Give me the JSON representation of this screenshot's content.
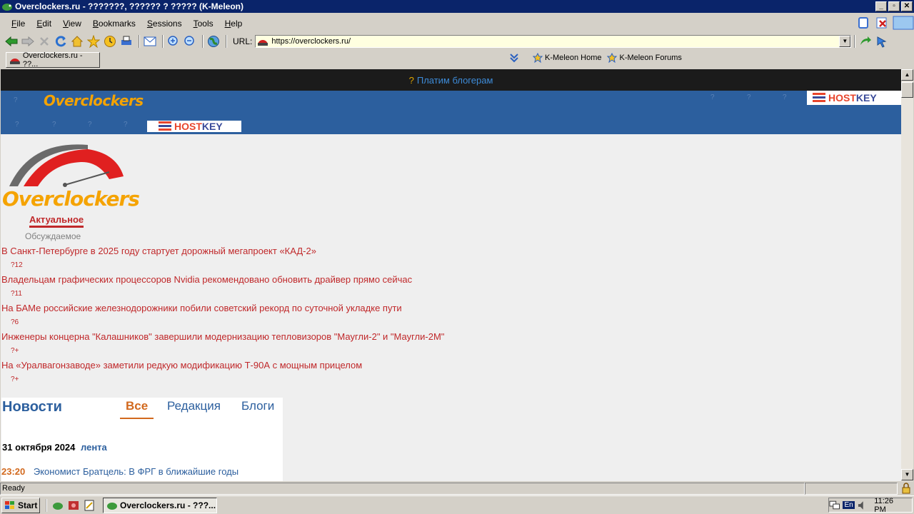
{
  "window": {
    "title": "Overclockers.ru - ???????, ?????? ? ????? (K-Meleon)"
  },
  "menu": {
    "items": [
      "File",
      "Edit",
      "View",
      "Bookmarks",
      "Sessions",
      "Tools",
      "Help"
    ],
    "accel": [
      "F",
      "E",
      "V",
      "B",
      "S",
      "T",
      "H"
    ]
  },
  "toolbar": {
    "url_label": "URL:",
    "url": "https://overclockers.ru/"
  },
  "tabs": [
    {
      "label": "Overclockers.ru - ??..."
    }
  ],
  "bookmarks": [
    {
      "label": "K-Meleon Home"
    },
    {
      "label": "K-Meleon Forums"
    }
  ],
  "page": {
    "banner_mark": "?",
    "banner_text": "Платим блогерам",
    "header_logo": "Overclockers",
    "hostkey_a": "HOST",
    "hostkey_b": "KEY",
    "big_logo": "Overclockers",
    "nav_active": "Актуальное",
    "nav_other": "Обсуждаемое",
    "news": [
      {
        "title": "В Санкт-Петербурге в 2025 году стартует дорожный мегапроект «КАД-2»",
        "meta": "?12"
      },
      {
        "title": "Владельцам графических процессоров Nvidia рекомендовано обновить драйвер прямо сейчас",
        "meta": "?11"
      },
      {
        "title": "На БАМе российские железнодорожники побили советский рекорд по суточной укладке пути",
        "meta": "?6"
      },
      {
        "title": "Инженеры концерна \"Калашников\" завершили модернизацию тепловизоров \"Маугли-2\" и \"Маугли-2М\"",
        "meta": "?+"
      },
      {
        "title": "На «Уралвагонзаводе» заметили редкую модификацию Т-90А с мощным прицелом",
        "meta": "?+"
      }
    ],
    "newsbox": {
      "heading": "Новости",
      "tabs": [
        "Все",
        "Редакция",
        "Блоги"
      ],
      "date": "31 октября 2024",
      "lenta": "лента",
      "item_time": "23:20",
      "item_text": "Экономист Братцель: В ФРГ в ближайшие годы"
    }
  },
  "status": {
    "text": "Ready"
  },
  "taskbar": {
    "start": "Start",
    "task": "Overclockers.ru - ???...",
    "lang": "En",
    "clock": "11:26 PM"
  }
}
